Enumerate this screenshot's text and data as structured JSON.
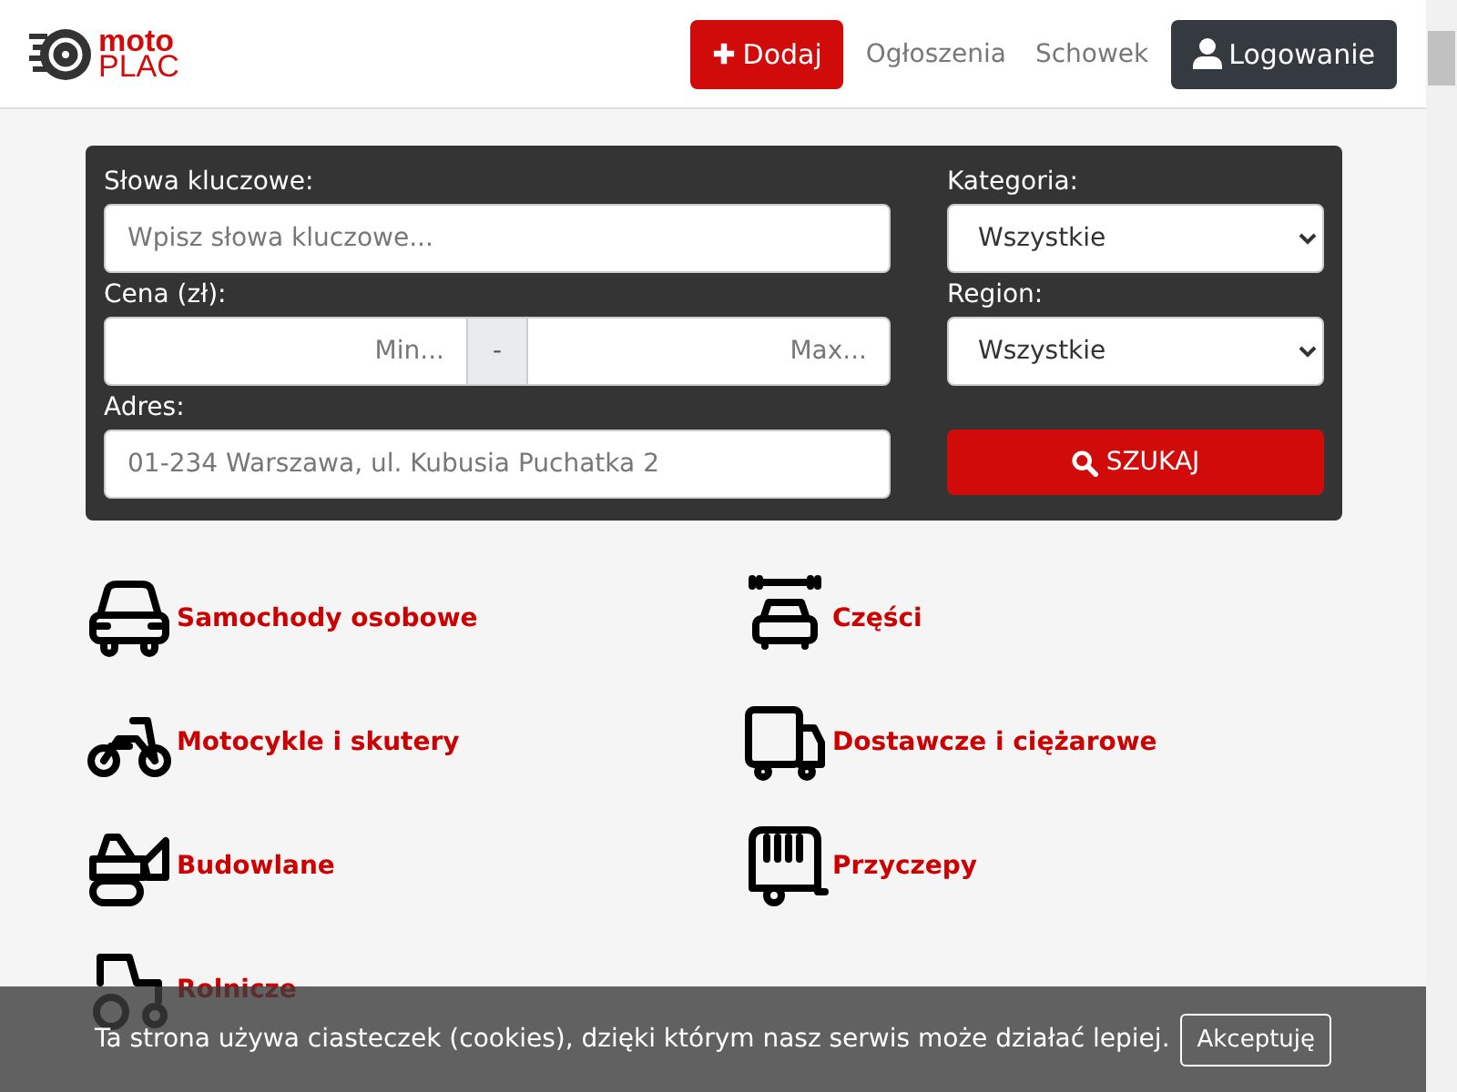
{
  "header": {
    "logo": {
      "top": "moto",
      "bottom": "PLAC"
    },
    "add_button": "Dodaj",
    "nav_links": [
      "Ogłoszenia",
      "Schowek"
    ],
    "login_button": "Logowanie"
  },
  "search": {
    "keywords": {
      "label": "Słowa kluczowe:",
      "placeholder": "Wpisz słowa kluczowe..."
    },
    "category": {
      "label": "Kategoria:",
      "value": "Wszystkie"
    },
    "price": {
      "label": "Cena (zł):",
      "min_placeholder": "Min...",
      "separator": "-",
      "max_placeholder": "Max..."
    },
    "region": {
      "label": "Region:",
      "value": "Wszystkie"
    },
    "address": {
      "label": "Adres:",
      "placeholder": "01-234 Warszawa, ul. Kubusia Puchatka 2"
    },
    "button": "SZUKAJ"
  },
  "categories": [
    {
      "kind": "car",
      "label": "Samochody osobowe"
    },
    {
      "kind": "parts",
      "label": "Części"
    },
    {
      "kind": "motorcycle",
      "label": "Motocykle i skutery"
    },
    {
      "kind": "truck",
      "label": "Dostawcze i ciężarowe"
    },
    {
      "kind": "excavator",
      "label": "Budowlane"
    },
    {
      "kind": "trailer",
      "label": "Przyczepy"
    },
    {
      "kind": "tractor",
      "label": "Rolnicze"
    }
  ],
  "cookie_bar": {
    "text": "Ta strona używa ciasteczek (cookies), dzięki którym nasz serwis może działać lepiej.",
    "button": "Akceptuję"
  }
}
